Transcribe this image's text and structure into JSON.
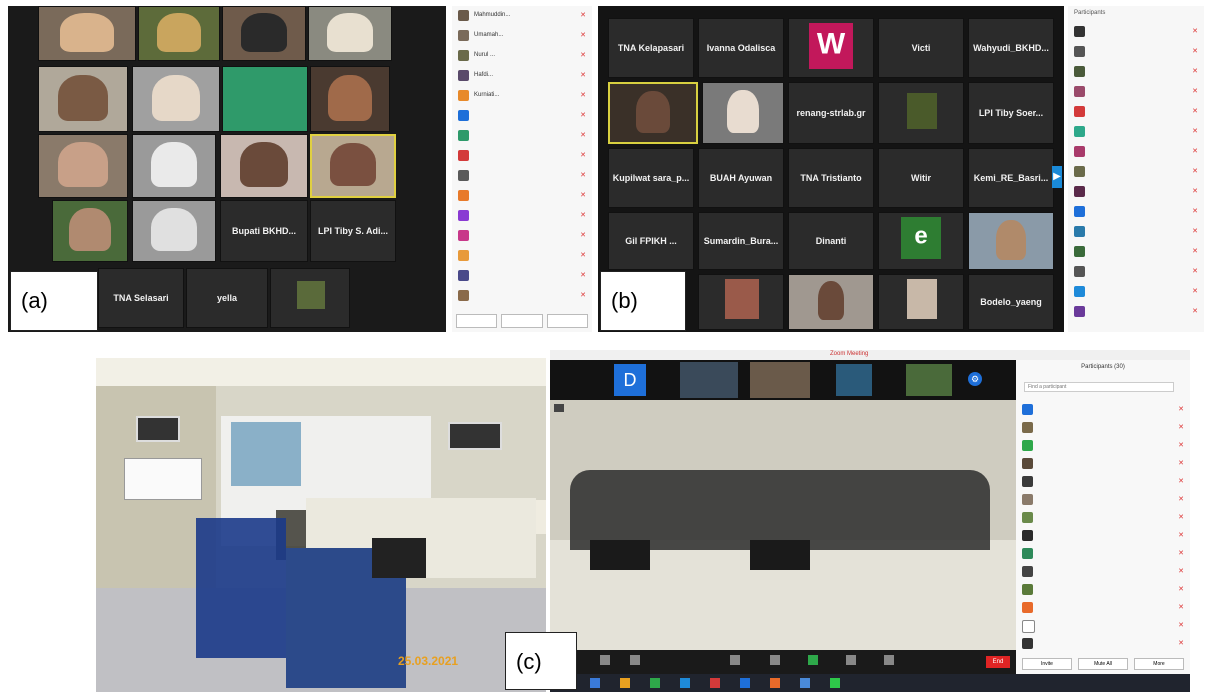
{
  "panel_a": {
    "label": "(a)",
    "tiles_text": [
      "Bupati BKHD...",
      "LPI Tiby S. Adi...",
      "TNA Selasari",
      "yella"
    ],
    "participant_names": [
      "Mahmuddin...",
      "Umamah...",
      "Nurul ...",
      "Hafdi...",
      "Kurniati..."
    ]
  },
  "panel_b": {
    "label": "(b)",
    "tiles_text": [
      "TNA Kelapasari",
      "Ivanna Odalisca",
      "W",
      "Victi",
      "Wahyudi_BKHD...",
      "renang-strlab.gr",
      "LPI Tiby Soer...",
      "Kupilwat sara_p...",
      "BUAH Ayuwan",
      "TNA Tristianto",
      "Witir",
      "Kemi_RE_Basri...",
      "Gil FPIKH ...",
      "Sumardin_Bura...",
      "Dinanti",
      "e",
      "Bodelo_yaeng"
    ],
    "header": "Participants"
  },
  "panel_c": {
    "label": "(c)",
    "photo_date": "25.03.2021",
    "window_title": "Zoom Meeting",
    "top_letter": "D",
    "participants_header": "Participants (30)",
    "search_placeholder": "Find a participant",
    "bottom_buttons": [
      "Invite",
      "Mute All",
      "More"
    ],
    "end_button": "End"
  },
  "colors": {
    "zoom_bg": "#1a1a1a",
    "tile_bg": "#2b2b2b",
    "sidebar_bg": "#f7f7f7",
    "end_red": "#e02424",
    "pink_tile": "#c2185b",
    "green_tile": "#2e7d32",
    "blue_tile": "#1e6fd9"
  }
}
